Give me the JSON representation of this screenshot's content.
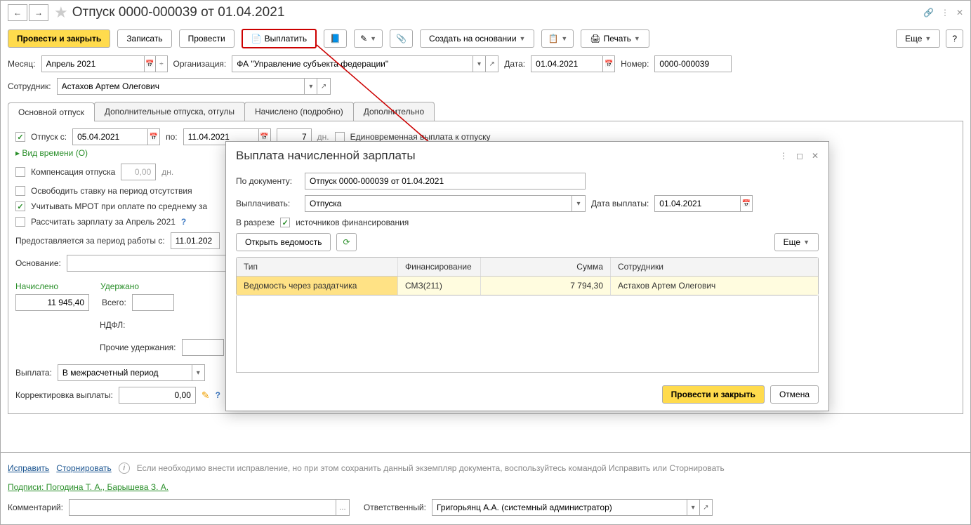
{
  "title": "Отпуск 0000-000039 от 01.04.2021",
  "toolbar": {
    "post_close": "Провести и закрыть",
    "save": "Записать",
    "post": "Провести",
    "pay": "Выплатить",
    "create_based": "Создать на основании",
    "print": "Печать",
    "more": "Еще"
  },
  "fields": {
    "month_label": "Месяц:",
    "month_value": "Апрель 2021",
    "org_label": "Организация:",
    "org_value": "ФА \"Управление субъекта федерации\"",
    "date_label": "Дата:",
    "date_value": "01.04.2021",
    "num_label": "Номер:",
    "num_value": "0000-000039",
    "emp_label": "Сотрудник:",
    "emp_value": "Астахов Артем Олегович"
  },
  "tabs": {
    "t1": "Основной отпуск",
    "t2": "Дополнительные отпуска, отгулы",
    "t3": "Начислено (подробно)",
    "t4": "Дополнительно"
  },
  "main_tab": {
    "vacation": "Отпуск  с:",
    "date_from": "05.04.2021",
    "to": "по:",
    "date_to": "11.04.2021",
    "days": "7",
    "days_lbl": "дн.",
    "one_time": "Единовременная выплата к отпуску",
    "time_type": "Вид времени (О)",
    "comp": "Компенсация отпуска",
    "comp_val": "0,00",
    "comp_unit": "дн.",
    "release": "Освободить ставку на период отсутствия",
    "mrot": "Учитывать МРОТ при оплате по среднему за",
    "calc": "Рассчитать зарплату за Апрель 2021",
    "period": "Предоставляется за период работы с:",
    "period_from": "11.01.202",
    "basis": "Основание:",
    "accrued": "Начислено",
    "withheld": "Удержано",
    "accrued_val": "11 945,40",
    "total": "Всего:",
    "ndfl": "НДФЛ:",
    "other": "Прочие удержания:",
    "payout": "Выплата:",
    "payout_val": "В межрасчетный период",
    "correction": "Корректировка выплаты:",
    "correction_val": "0,00"
  },
  "bottom": {
    "fix": "Исправить",
    "reverse": "Сторнировать",
    "note": "Если необходимо внести исправление, но при этом сохранить данный экземпляр документа, воспользуйтесь командой Исправить или Сторнировать",
    "signatures": "Подписи: Погодина Т. А., Барышева З. А.",
    "comment": "Комментарий:",
    "resp": "Ответственный:",
    "resp_val": "Григорьянц А.А. (системный администратор)"
  },
  "dialog": {
    "title": "Выплата начисленной зарплаты",
    "by_doc": "По документу:",
    "by_doc_val": "Отпуск 0000-000039 от 01.04.2021",
    "pay_method": "Выплачивать:",
    "pay_method_val": "Отпуска",
    "pay_date": "Дата выплаты:",
    "pay_date_val": "01.04.2021",
    "slice": "В разрезе",
    "slice_opt": "источников финансирования",
    "open_sheet": "Открыть ведомость",
    "more": "Еще",
    "cols": {
      "type": "Тип",
      "fin": "Финансирование",
      "sum": "Сумма",
      "emps": "Сотрудники"
    },
    "row": {
      "type": "Ведомость через раздатчика",
      "fin": "СМЗ(211)",
      "sum": "7 794,30",
      "emp": "Астахов Артем Олегович"
    },
    "post_close": "Провести и закрыть",
    "cancel": "Отмена"
  }
}
